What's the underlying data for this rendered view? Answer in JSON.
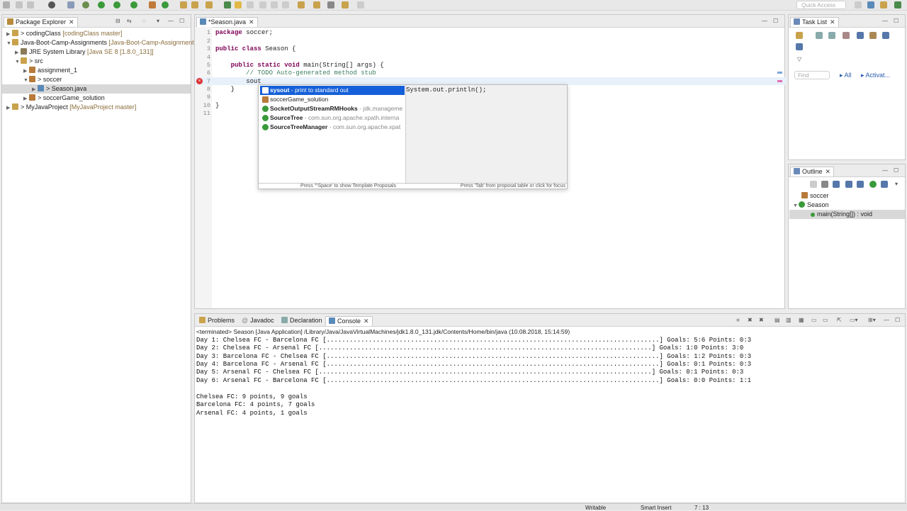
{
  "quick_access_placeholder": "Quick Access",
  "package_explorer": {
    "title": "Package Explorer",
    "items": [
      {
        "label": "> codingClass",
        "decoration": "[codingClass master]"
      },
      {
        "label": "Java-Boot-Camp-Assignments",
        "decoration": "[Java-Boot-Camp-Assignments master]"
      },
      {
        "label": "JRE System Library",
        "decoration": "[Java SE 8 [1.8.0_131]]"
      },
      {
        "label": "> src",
        "decoration": ""
      },
      {
        "label": "assignment_1",
        "decoration": ""
      },
      {
        "label": "> soccer",
        "decoration": ""
      },
      {
        "label": "> Season.java",
        "decoration": ""
      },
      {
        "label": "> soccerGame_solution",
        "decoration": ""
      },
      {
        "label": "> MyJavaProject",
        "decoration": "[MyJavaProject master]"
      }
    ]
  },
  "editor": {
    "tab": "*Season.java",
    "lines": [
      {
        "n": "1",
        "text": "package soccer;"
      },
      {
        "n": "2",
        "text": ""
      },
      {
        "n": "3",
        "text": "public class Season {"
      },
      {
        "n": "4",
        "text": ""
      },
      {
        "n": "5",
        "text": "    public static void main(String[] args) {"
      },
      {
        "n": "6",
        "text": "        // TODO Auto-generated method stub"
      },
      {
        "n": "7",
        "text": "        sout"
      },
      {
        "n": "8",
        "text": "    }"
      },
      {
        "n": "9",
        "text": ""
      },
      {
        "n": "10",
        "text": "}"
      },
      {
        "n": "11",
        "text": ""
      }
    ]
  },
  "autocomplete": {
    "proposals": [
      {
        "bold": "sysout",
        "rest": " - print to standard out",
        "extra": ""
      },
      {
        "bold": "soccerGame_solution",
        "rest": "",
        "extra": ""
      },
      {
        "bold": "SocketOutputStreamRMHooks",
        "rest": "",
        "extra": " - jdk.manageme"
      },
      {
        "bold": "SourceTree",
        "rest": "",
        "extra": " - com.sun.org.apache.xpath.interna"
      },
      {
        "bold": "SourceTreeManager",
        "rest": "",
        "extra": " - com.sun.org.apache.xpat"
      }
    ],
    "preview": "System.out.println();",
    "footer_left": "Press '^Space' to show Template Proposals",
    "footer_right": "Press 'Tab' from proposal table or click for focus"
  },
  "task_list": {
    "title": "Task List",
    "find_placeholder": "Find",
    "all_label": "All",
    "activate_label": "Activat..."
  },
  "outline": {
    "title": "Outline",
    "items": [
      {
        "label": "soccer"
      },
      {
        "label": "Season"
      },
      {
        "label": "main(String[]) : void"
      }
    ]
  },
  "bottom_tabs": [
    "Problems",
    "Javadoc",
    "Declaration",
    "Console"
  ],
  "console": {
    "header": "<terminated> Season [Java Application] /Library/Java/JavaVirtualMachines/jdk1.8.0_131.jdk/Contents/Home/bin/java (10.08.2018, 15:14:59)",
    "lines": [
      "Day 1: Chelsea FC - Barcelona FC [.......................................................................................] Goals: 5:6 Points: 0:3",
      "Day 2: Chelsea FC - Arsenal FC [.......................................................................................] Goals: 1:0 Points: 3:0",
      "Day 3: Barcelona FC - Chelsea FC [.......................................................................................] Goals: 1:2 Points: 0:3",
      "Day 4: Barcelona FC - Arsenal FC [.......................................................................................] Goals: 0:1 Points: 0:3",
      "Day 5: Arsenal FC - Chelsea FC [.......................................................................................] Goals: 0:1 Points: 0:3",
      "Day 6: Arsenal FC - Barcelona FC [.......................................................................................] Goals: 0:0 Points: 1:1",
      "",
      "Chelsea FC: 9 points, 9 goals",
      "Barcelona FC: 4 points, 7 goals",
      "Arsenal FC: 4 points, 1 goals"
    ]
  },
  "status": {
    "writable": "Writable",
    "insert": "Smart Insert",
    "position": "7 : 13"
  }
}
